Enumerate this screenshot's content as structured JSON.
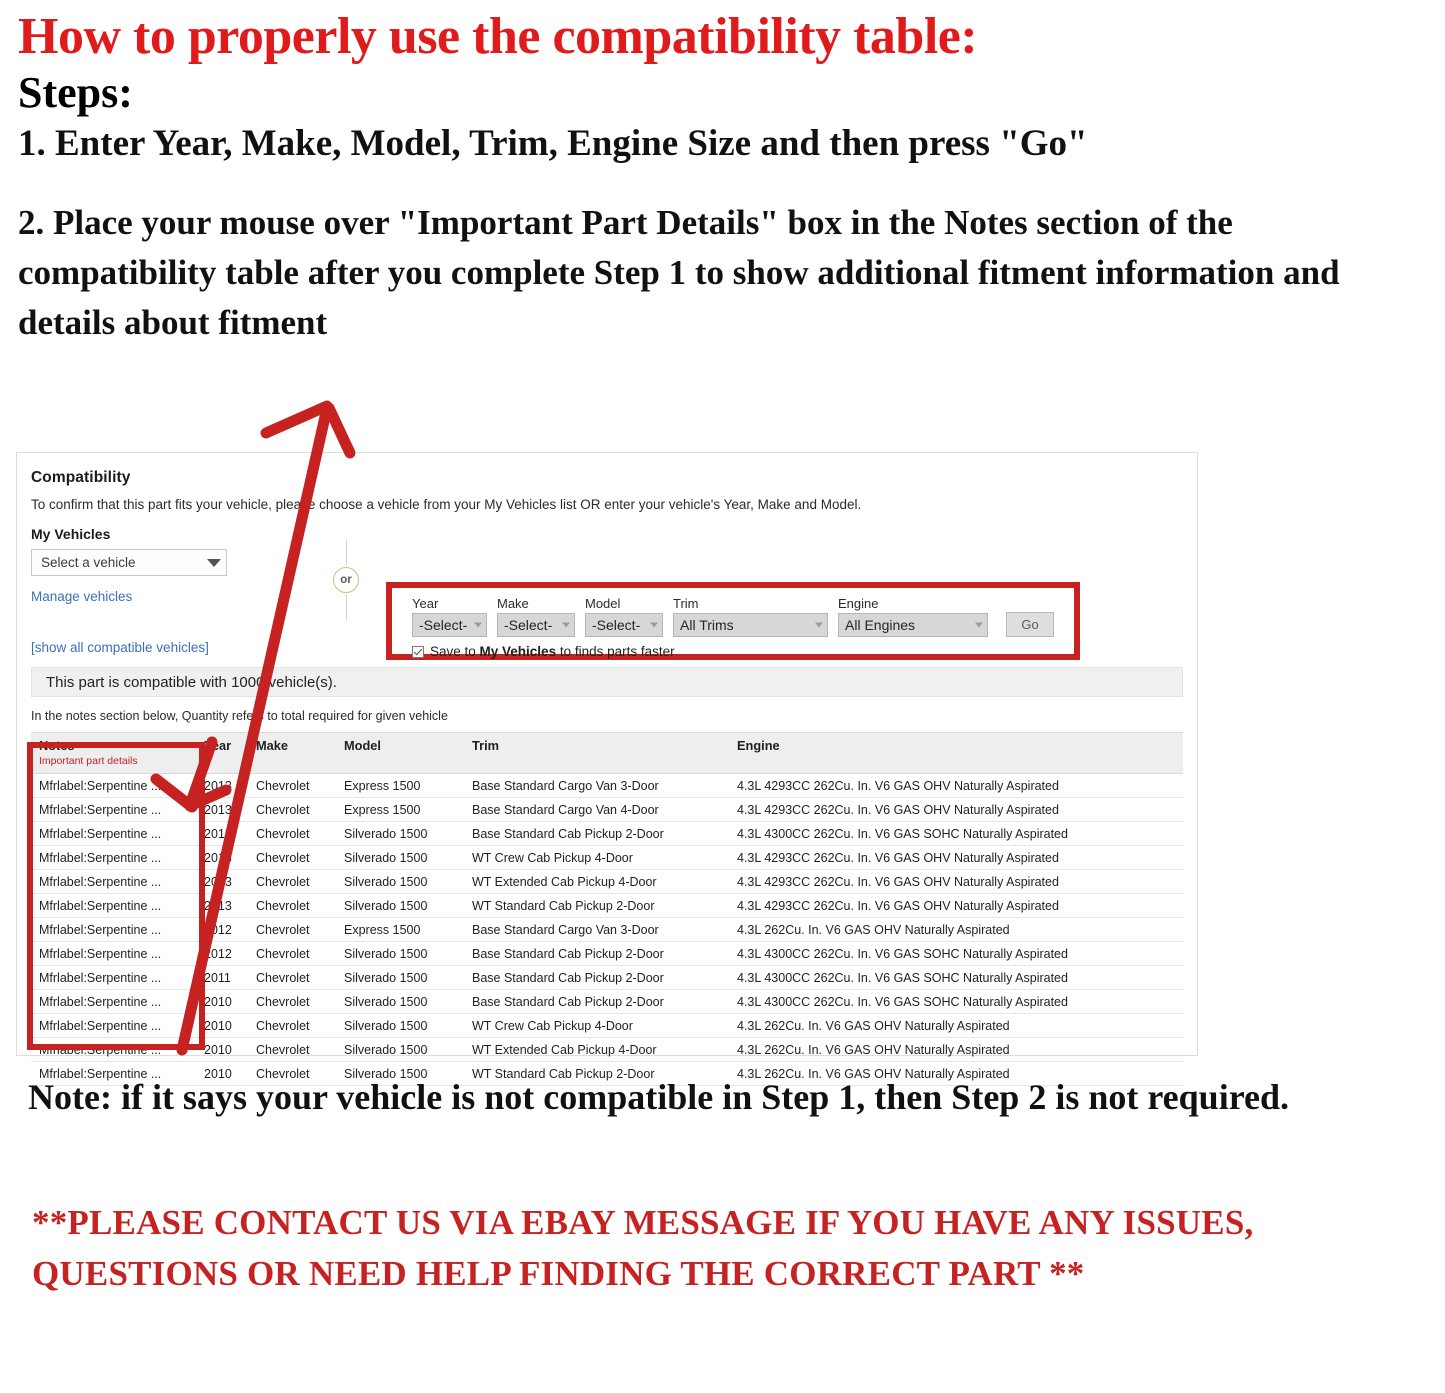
{
  "instructions": {
    "heading": "How to properly use the compatibility table:",
    "steps_label": "Steps:",
    "step1": "1. Enter Year, Make, Model, Trim, Engine Size and then press \"Go\"",
    "step2": "2. Place your mouse over \"Important Part Details\" box in the Notes section of the compatibility table after you complete Step 1 to show additional fitment information and details about fitment"
  },
  "compatibility": {
    "title": "Compatibility",
    "subtitle": "To confirm that this part fits your vehicle, please choose a vehicle from your My Vehicles list OR enter your vehicle's Year, Make and Model.",
    "my_vehicles_label": "My Vehicles",
    "vehicle_select_value": "Select a vehicle",
    "manage_vehicles_link": "Manage vehicles",
    "or_label": "or",
    "show_all_link": "[show all compatible vehicles]",
    "count_text": "This part is compatible with 1000 vehicle(s).",
    "qty_note": "In the notes section below, Quantity refers to total required for given vehicle",
    "form": {
      "year_label": "Year",
      "year_value": "-Select-",
      "make_label": "Make",
      "make_value": "-Select-",
      "model_label": "Model",
      "model_value": "-Select-",
      "trim_label": "Trim",
      "trim_value": "All Trims",
      "engine_label": "Engine",
      "engine_value": "All Engines",
      "go_label": "Go",
      "save_prefix": "Save to ",
      "save_bold": "My Vehicles",
      "save_suffix": " to finds parts faster"
    }
  },
  "table": {
    "headers": {
      "notes": "Notes",
      "notes_sub": "Important part details",
      "year": "Year",
      "make": "Make",
      "model": "Model",
      "trim": "Trim",
      "engine": "Engine"
    },
    "rows": [
      {
        "notes": "Mfrlabel:Serpentine ...",
        "year": "2013",
        "make": "Chevrolet",
        "model": "Express 1500",
        "trim": "Base Standard Cargo Van 3-Door",
        "engine": "4.3L 4293CC 262Cu. In. V6 GAS OHV Naturally Aspirated"
      },
      {
        "notes": "Mfrlabel:Serpentine ...",
        "year": "2013",
        "make": "Chevrolet",
        "model": "Express 1500",
        "trim": "Base Standard Cargo Van 4-Door",
        "engine": "4.3L 4293CC 262Cu. In. V6 GAS OHV Naturally Aspirated"
      },
      {
        "notes": "Mfrlabel:Serpentine ...",
        "year": "2013",
        "make": "Chevrolet",
        "model": "Silverado 1500",
        "trim": "Base Standard Cab Pickup 2-Door",
        "engine": "4.3L 4300CC 262Cu. In. V6 GAS SOHC Naturally Aspirated"
      },
      {
        "notes": "Mfrlabel:Serpentine ...",
        "year": "2013",
        "make": "Chevrolet",
        "model": "Silverado 1500",
        "trim": "WT Crew Cab Pickup 4-Door",
        "engine": "4.3L 4293CC 262Cu. In. V6 GAS OHV Naturally Aspirated"
      },
      {
        "notes": "Mfrlabel:Serpentine ...",
        "year": "2013",
        "make": "Chevrolet",
        "model": "Silverado 1500",
        "trim": "WT Extended Cab Pickup 4-Door",
        "engine": "4.3L 4293CC 262Cu. In. V6 GAS OHV Naturally Aspirated"
      },
      {
        "notes": "Mfrlabel:Serpentine ...",
        "year": "2013",
        "make": "Chevrolet",
        "model": "Silverado 1500",
        "trim": "WT Standard Cab Pickup 2-Door",
        "engine": "4.3L 4293CC 262Cu. In. V6 GAS OHV Naturally Aspirated"
      },
      {
        "notes": "Mfrlabel:Serpentine ...",
        "year": "2012",
        "make": "Chevrolet",
        "model": "Express 1500",
        "trim": "Base Standard Cargo Van 3-Door",
        "engine": "4.3L 262Cu. In. V6 GAS OHV Naturally Aspirated"
      },
      {
        "notes": "Mfrlabel:Serpentine ...",
        "year": "2012",
        "make": "Chevrolet",
        "model": "Silverado 1500",
        "trim": "Base Standard Cab Pickup 2-Door",
        "engine": "4.3L 4300CC 262Cu. In. V6 GAS SOHC Naturally Aspirated"
      },
      {
        "notes": "Mfrlabel:Serpentine ...",
        "year": "2011",
        "make": "Chevrolet",
        "model": "Silverado 1500",
        "trim": "Base Standard Cab Pickup 2-Door",
        "engine": "4.3L 4300CC 262Cu. In. V6 GAS SOHC Naturally Aspirated"
      },
      {
        "notes": "Mfrlabel:Serpentine ...",
        "year": "2010",
        "make": "Chevrolet",
        "model": "Silverado 1500",
        "trim": "Base Standard Cab Pickup 2-Door",
        "engine": "4.3L 4300CC 262Cu. In. V6 GAS SOHC Naturally Aspirated"
      },
      {
        "notes": "Mfrlabel:Serpentine ...",
        "year": "2010",
        "make": "Chevrolet",
        "model": "Silverado 1500",
        "trim": "WT Crew Cab Pickup 4-Door",
        "engine": "4.3L 262Cu. In. V6 GAS OHV Naturally Aspirated"
      },
      {
        "notes": "Mfrlabel:Serpentine ...",
        "year": "2010",
        "make": "Chevrolet",
        "model": "Silverado 1500",
        "trim": "WT Extended Cab Pickup 4-Door",
        "engine": "4.3L 262Cu. In. V6 GAS OHV Naturally Aspirated"
      },
      {
        "notes": "Mfrlabel:Serpentine ...",
        "year": "2010",
        "make": "Chevrolet",
        "model": "Silverado 1500",
        "trim": "WT Standard Cab Pickup 2-Door",
        "engine": "4.3L 262Cu. In. V6 GAS OHV Naturally Aspirated"
      }
    ]
  },
  "footer": {
    "note": "Note: if it says your vehicle is not compatible in Step 1, then Step 2 is not required.",
    "contact": "**PLEASE CONTACT US VIA EBAY MESSAGE IF YOU HAVE ANY ISSUES, QUESTIONS OR NEED HELP FINDING THE CORRECT PART **"
  },
  "colors": {
    "red": "#c62222",
    "heading_red": "#e01b1b",
    "link_blue": "#3a72b8",
    "or_gold": "#d4bd7a"
  }
}
